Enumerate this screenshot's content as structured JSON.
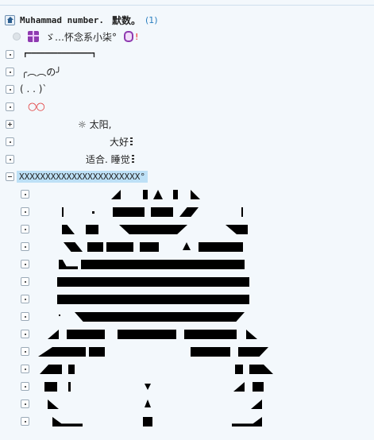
{
  "header": {
    "title_mono": "Muhammad number.",
    "title_cn": "默数。",
    "count": "(1)"
  },
  "user": {
    "nickname": "ゞ…怀念系小柒°",
    "mark": "!"
  },
  "tree": {
    "items": [
      {
        "text": "┏━━━━━━━━━━━━━━━┓",
        "toggle": "dot"
      },
      {
        "text": "╭︵︵の╯",
        "toggle": "dot"
      },
      {
        "text": "( . . )`",
        "toggle": "dot"
      },
      {
        "text": "○○",
        "toggle": "dot"
      },
      {
        "text": "☼ 太阳,",
        "toggle": "plus"
      },
      {
        "text": "大好",
        "toggle": "dot"
      },
      {
        "text": "适合. 睡觉",
        "toggle": "dot"
      }
    ],
    "group_label": "XXXXXXXXXXXXXXXXXXXXXXX°",
    "group_toggle": "minus"
  },
  "colors": {
    "background": "#f3f8fc",
    "highlight": "#bde0f6",
    "accent": "#2a7fc0",
    "gift": "#8e3ab0"
  },
  "icons": [
    "home-icon",
    "gift-icon",
    "badge-icon",
    "sun-icon"
  ]
}
